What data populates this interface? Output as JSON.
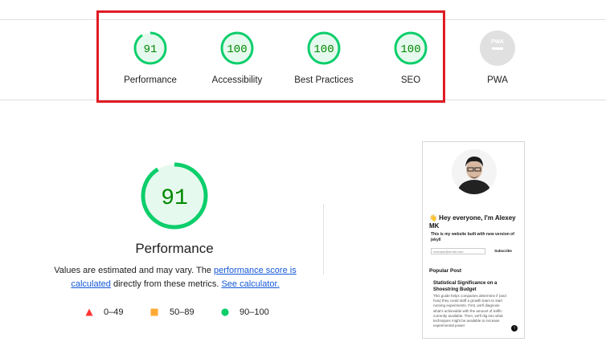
{
  "summary": {
    "scores": [
      {
        "label": "Performance",
        "value": "91",
        "status": "pass"
      },
      {
        "label": "Accessibility",
        "value": "100",
        "status": "pass"
      },
      {
        "label": "Best Practices",
        "value": "100",
        "status": "pass"
      },
      {
        "label": "SEO",
        "value": "100",
        "status": "pass"
      },
      {
        "label": "PWA",
        "value": "PWA",
        "status": "na"
      }
    ]
  },
  "main": {
    "score": "91",
    "title": "Performance",
    "desc_pre": "Values are estimated and may vary. The ",
    "desc_link1": "performance score is calculated",
    "desc_mid": " directly from these metrics. ",
    "desc_link2": "See calculator."
  },
  "legend": [
    {
      "range": "0–49",
      "shape": "triangle",
      "color": "#ff3333"
    },
    {
      "range": "50–89",
      "shape": "square",
      "color": "#ffaa33"
    },
    {
      "range": "90–100",
      "shape": "circle",
      "color": "#0cce6b"
    }
  ],
  "colors": {
    "pass": "#0cce6b",
    "pass_text": "#008800",
    "pass_bg": "#e6f9ee",
    "na": "#9e9e9e",
    "highlight": "#e01b24"
  },
  "screenshot": {
    "greeting": "👋 Hey everyone, I'm Alexey MK",
    "subtitle": "This is my website built with new version of jekyll",
    "email_placeholder": "example@email.com",
    "subscribe_label": "Subscribe",
    "section_title": "Popular Post",
    "post_title": "Statistical Significance on a Shoestring Budget",
    "post_excerpt": "This guide helps companies determine if (and how) they could staff a growth team to start running experiments. First, we'll diagnose what's achievable with the amount of traffic currently available. Then, we'll dig into what techniques might be available to increase experimental power"
  }
}
